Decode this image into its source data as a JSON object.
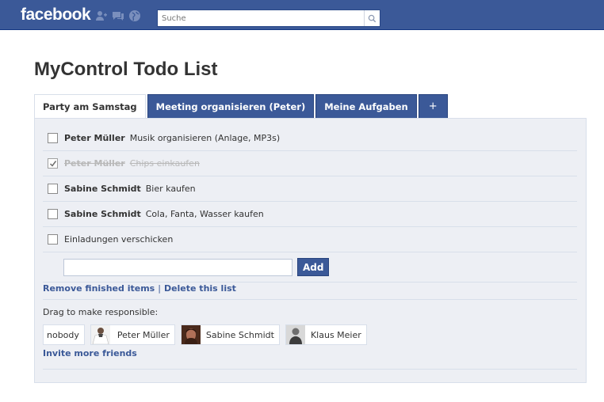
{
  "header": {
    "logo": "facebook",
    "search_placeholder": "Suche"
  },
  "page": {
    "title": "MyControl Todo List"
  },
  "tabs": [
    {
      "label": "Party am Samstag",
      "active": true
    },
    {
      "label": "Meeting organisieren (Peter)",
      "active": false
    },
    {
      "label": "Meine Aufgaben",
      "active": false
    },
    {
      "label": "+",
      "active": false
    }
  ],
  "todos": [
    {
      "person": "Peter Müller",
      "task": "Musik organisieren (Anlage, MP3s)",
      "done": false
    },
    {
      "person": "Peter Müller",
      "task": "Chips einkaufen",
      "done": true
    },
    {
      "person": "Sabine Schmidt",
      "task": "Bier kaufen",
      "done": false
    },
    {
      "person": "Sabine Schmidt",
      "task": "Cola, Fanta, Wasser kaufen",
      "done": false
    },
    {
      "person": "",
      "task": "Einladungen verschicken",
      "done": false
    }
  ],
  "add_form": {
    "value": "",
    "button_label": "Add"
  },
  "actions": {
    "remove_label": "Remove finished items",
    "separator": "|",
    "delete_label": "Delete this list"
  },
  "responsible": {
    "label": "Drag to make responsible:",
    "people": [
      "nobody",
      "Peter Müller",
      "Sabine Schmidt",
      "Klaus Meier"
    ]
  },
  "invite_label": "Invite more friends",
  "colors": {
    "brand": "#3b5998",
    "panel_bg": "#edeff4",
    "border": "#d8dfea"
  }
}
